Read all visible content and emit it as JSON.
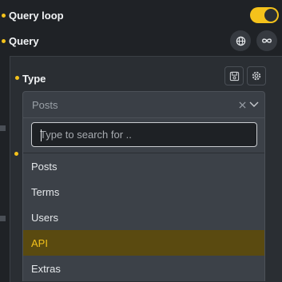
{
  "query_loop": {
    "label": "Query loop",
    "enabled": true
  },
  "query": {
    "label": "Query"
  },
  "type_field": {
    "label": "Type"
  },
  "select": {
    "value": "Posts"
  },
  "search": {
    "placeholder": "Type to search for .."
  },
  "options": [
    {
      "label": "Posts"
    },
    {
      "label": "Terms"
    },
    {
      "label": "Users"
    },
    {
      "label": "API"
    },
    {
      "label": "Extras"
    }
  ],
  "colors": {
    "accent": "#f4c21b",
    "background": "#1f2226",
    "panel": "#2a2e33",
    "highlight": "#5a4a10"
  },
  "icons": {
    "globe": "globe-icon",
    "infinity": "infinity-icon",
    "save": "save-icon",
    "settings": "gear-icon",
    "clear": "close-icon",
    "chevron": "chevron-down-icon"
  }
}
